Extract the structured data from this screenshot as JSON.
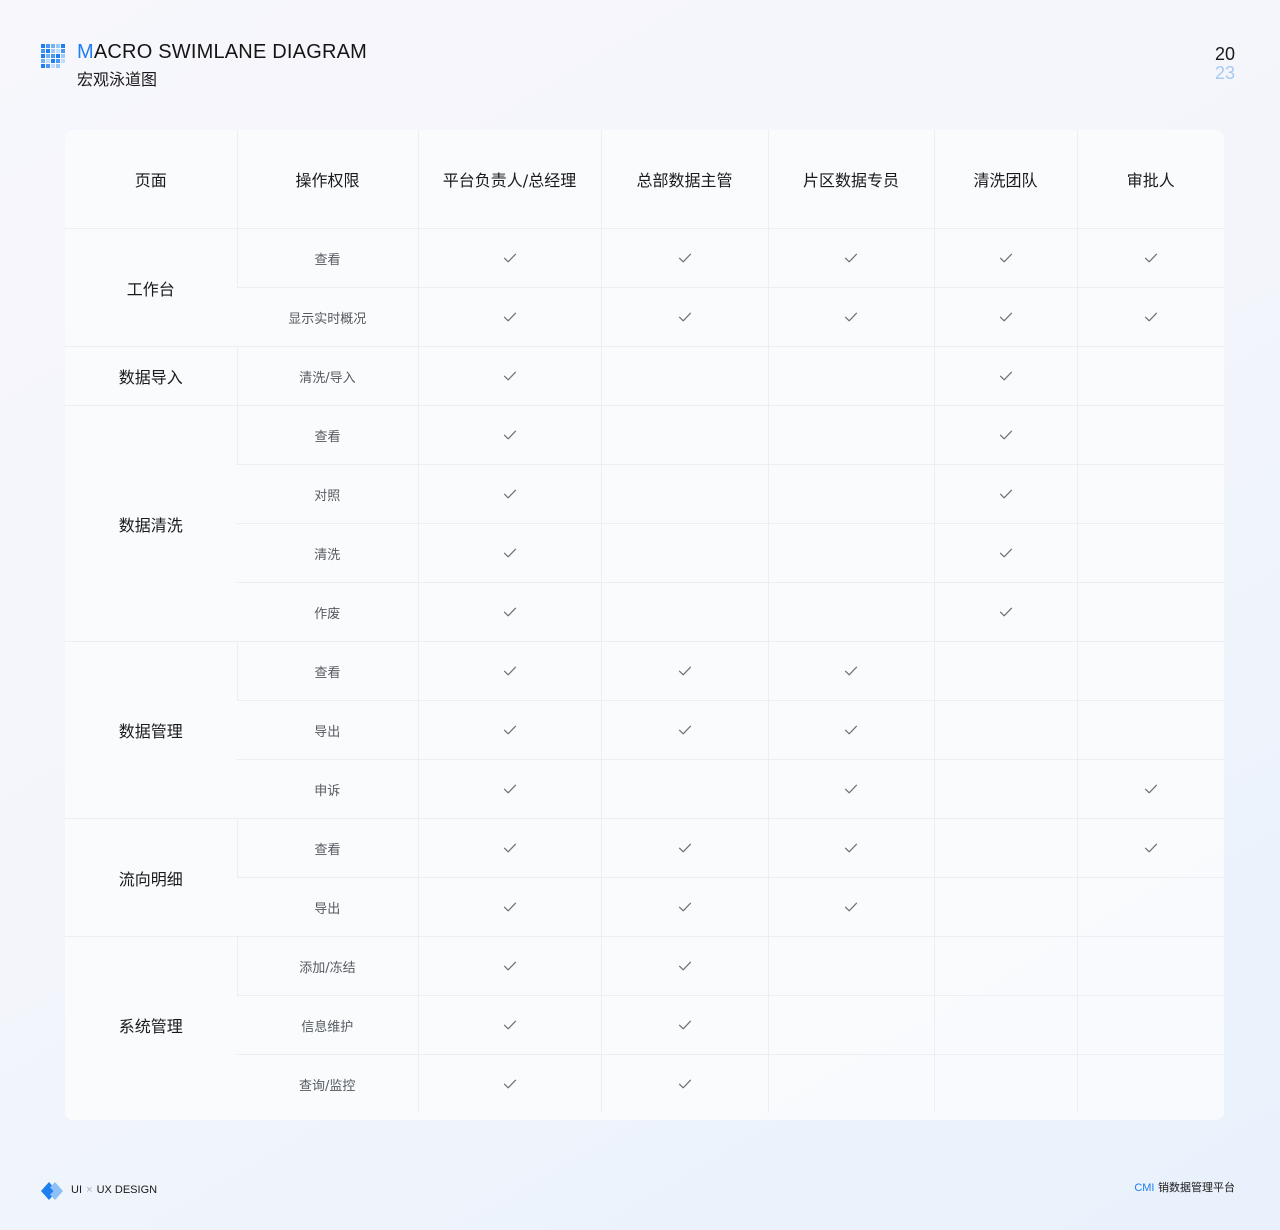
{
  "header": {
    "title_en_first": "M",
    "title_en_rest": "ACRO SWIMLANE DIAGRAM",
    "title_cn": "宏观泳道图",
    "year_top": "20",
    "year_bottom": "23",
    "accent_color": "#1f7ef0"
  },
  "table": {
    "headers": [
      "页面",
      "操作权限",
      "平台负责人/总经理",
      "总部数据主管",
      "片区数据专员",
      "清洗团队",
      "审批人"
    ],
    "check_icon": "check-icon",
    "groups": [
      {
        "page": "工作台",
        "rows": [
          {
            "op": "查看",
            "checks": [
              true,
              true,
              true,
              true,
              true
            ]
          },
          {
            "op": "显示实时概况",
            "checks": [
              true,
              true,
              true,
              true,
              true
            ]
          }
        ]
      },
      {
        "page": "数据导入",
        "rows": [
          {
            "op": "清洗/导入",
            "checks": [
              true,
              false,
              false,
              true,
              false
            ]
          }
        ]
      },
      {
        "page": "数据清洗",
        "rows": [
          {
            "op": "查看",
            "checks": [
              true,
              false,
              false,
              true,
              false
            ]
          },
          {
            "op": "对照",
            "checks": [
              true,
              false,
              false,
              true,
              false
            ]
          },
          {
            "op": "清洗",
            "checks": [
              true,
              false,
              false,
              true,
              false
            ]
          },
          {
            "op": "作废",
            "checks": [
              true,
              false,
              false,
              true,
              false
            ]
          }
        ]
      },
      {
        "page": "数据管理",
        "rows": [
          {
            "op": "查看",
            "checks": [
              true,
              true,
              true,
              false,
              false
            ]
          },
          {
            "op": "导出",
            "checks": [
              true,
              true,
              true,
              false,
              false
            ]
          },
          {
            "op": "申诉",
            "checks": [
              true,
              false,
              true,
              false,
              true
            ]
          }
        ]
      },
      {
        "page": "流向明细",
        "rows": [
          {
            "op": "查看",
            "checks": [
              true,
              true,
              true,
              false,
              true
            ]
          },
          {
            "op": "导出",
            "checks": [
              true,
              true,
              true,
              false,
              false
            ]
          }
        ]
      },
      {
        "page": "系统管理",
        "rows": [
          {
            "op": "添加/冻结",
            "checks": [
              true,
              true,
              false,
              false,
              false
            ]
          },
          {
            "op": "信息维护",
            "checks": [
              true,
              true,
              false,
              false,
              false
            ]
          },
          {
            "op": "查询/监控",
            "checks": [
              true,
              true,
              false,
              false,
              false
            ]
          }
        ]
      }
    ]
  },
  "footer": {
    "left_ui": "UI",
    "left_x": "×",
    "left_rest": "UX DESIGN",
    "right_brand": "CMI",
    "right_text": " 销数据管理平台"
  }
}
